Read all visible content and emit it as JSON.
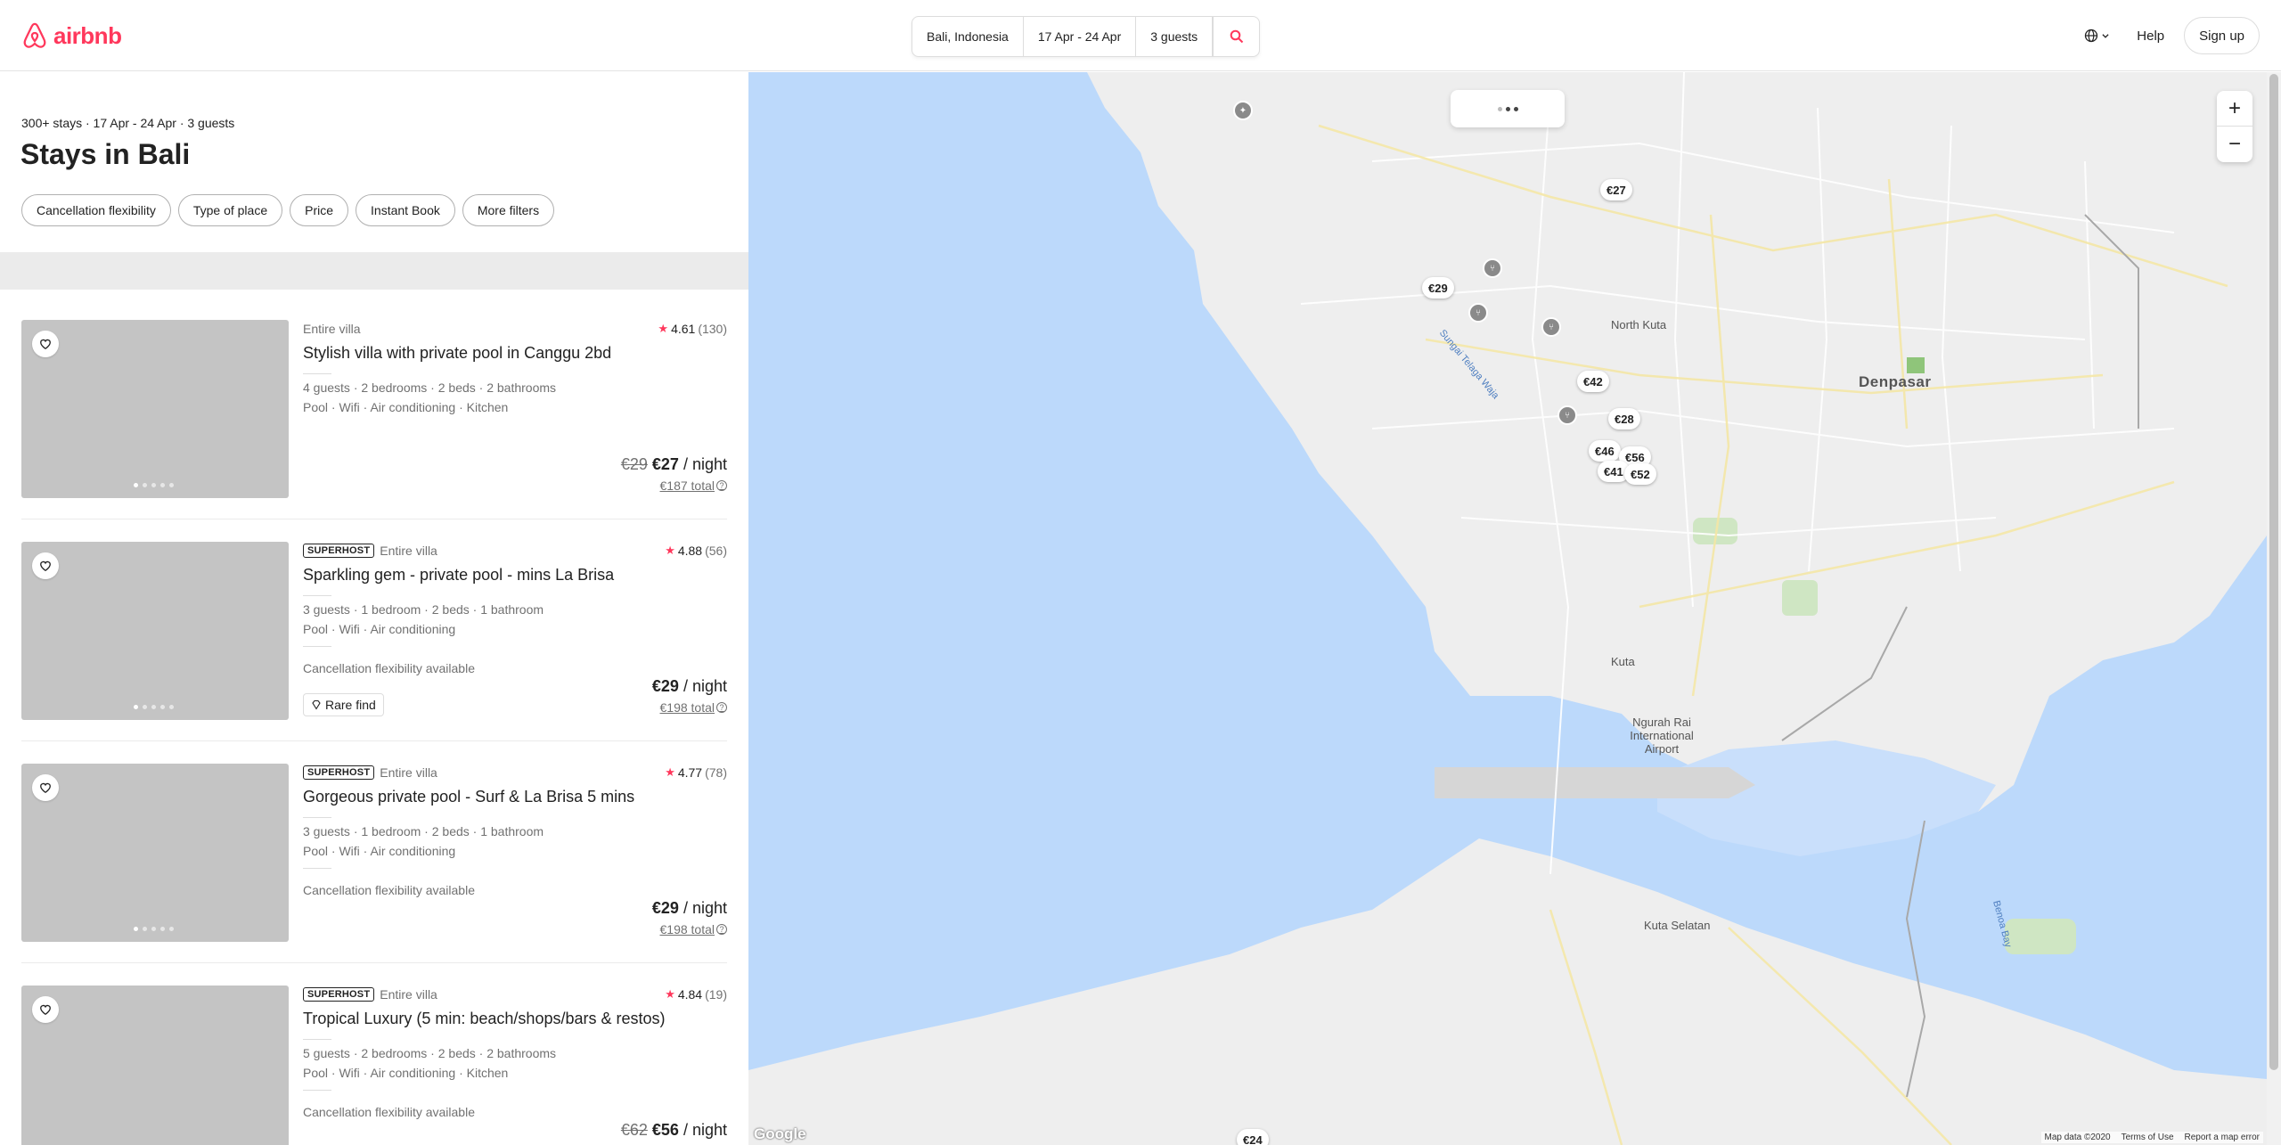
{
  "header": {
    "brand": "airbnb",
    "search": {
      "location": "Bali, Indonesia",
      "dates": "17 Apr - 24 Apr",
      "guests": "3 guests"
    },
    "help": "Help",
    "signup": "Sign up"
  },
  "results": {
    "summary": "300+ stays · 17 Apr - 24 Apr · 3 guests",
    "title": "Stays in Bali",
    "filters": [
      "Cancellation flexibility",
      "Type of place",
      "Price",
      "Instant Book",
      "More filters"
    ]
  },
  "listings": [
    {
      "superhost": "",
      "type": "Entire villa",
      "rating": "4.61",
      "reviews": "(130)",
      "title": "Stylish villa with private pool in Canggu 2bd",
      "specs": "4 guests · 2 bedrooms · 2 beds · 2 bathrooms",
      "amenities": "Pool · Wifi · Air conditioning · Kitchen",
      "cancellation": "",
      "badge": "",
      "old_price": "€29",
      "price": "€27",
      "per_night": " / night",
      "total": "€187 total"
    },
    {
      "superhost": "SUPERHOST",
      "type": "Entire villa",
      "rating": "4.88",
      "reviews": "(56)",
      "title": "Sparkling gem - private pool - mins La Brisa",
      "specs": "3 guests · 1 bedroom · 2 beds · 1 bathroom",
      "amenities": "Pool · Wifi · Air conditioning",
      "cancellation": "Cancellation flexibility available",
      "badge": "Rare find",
      "old_price": "",
      "price": "€29",
      "per_night": " / night",
      "total": "€198 total"
    },
    {
      "superhost": "SUPERHOST",
      "type": "Entire villa",
      "rating": "4.77",
      "reviews": "(78)",
      "title": "Gorgeous private pool - Surf & La Brisa 5 mins",
      "specs": "3 guests · 1 bedroom · 2 beds · 1 bathroom",
      "amenities": "Pool · Wifi · Air conditioning",
      "cancellation": "Cancellation flexibility available",
      "badge": "",
      "old_price": "",
      "price": "€29",
      "per_night": " / night",
      "total": "€198 total"
    },
    {
      "superhost": "SUPERHOST",
      "type": "Entire villa",
      "rating": "4.84",
      "reviews": "(19)",
      "title": "Tropical Luxury (5 min: beach/shops/bars & restos)",
      "specs": "5 guests · 2 bedrooms · 2 beds · 2 bathrooms",
      "amenities": "Pool · Wifi · Air conditioning · Kitchen",
      "cancellation": "Cancellation flexibility available",
      "badge": "",
      "old_price": "€62",
      "price": "€56",
      "per_night": " / night",
      "total": ""
    }
  ],
  "map": {
    "pins": [
      "€27",
      "€29",
      "€42",
      "€28",
      "€46",
      "€56",
      "€41",
      "€52",
      "€24"
    ],
    "places": {
      "denpasar": "Denpasar",
      "north_kuta": "North Kuta",
      "kuta": "Kuta",
      "airport": "Ngurah Rai International Airport",
      "kuta_selatan": "Kuta Selatan",
      "benoa": "Benoa Bay",
      "telaga_waja": "Sungai Telaga Waja"
    },
    "attribution": "Google",
    "map_data": "Map data ©2020",
    "terms": "Terms of Use",
    "report": "Report a map error",
    "zoom_in": "+",
    "zoom_out": "−"
  },
  "colors": {
    "brand": "#ff385c",
    "water": "#bcd9fb",
    "land": "#eeeeee"
  }
}
